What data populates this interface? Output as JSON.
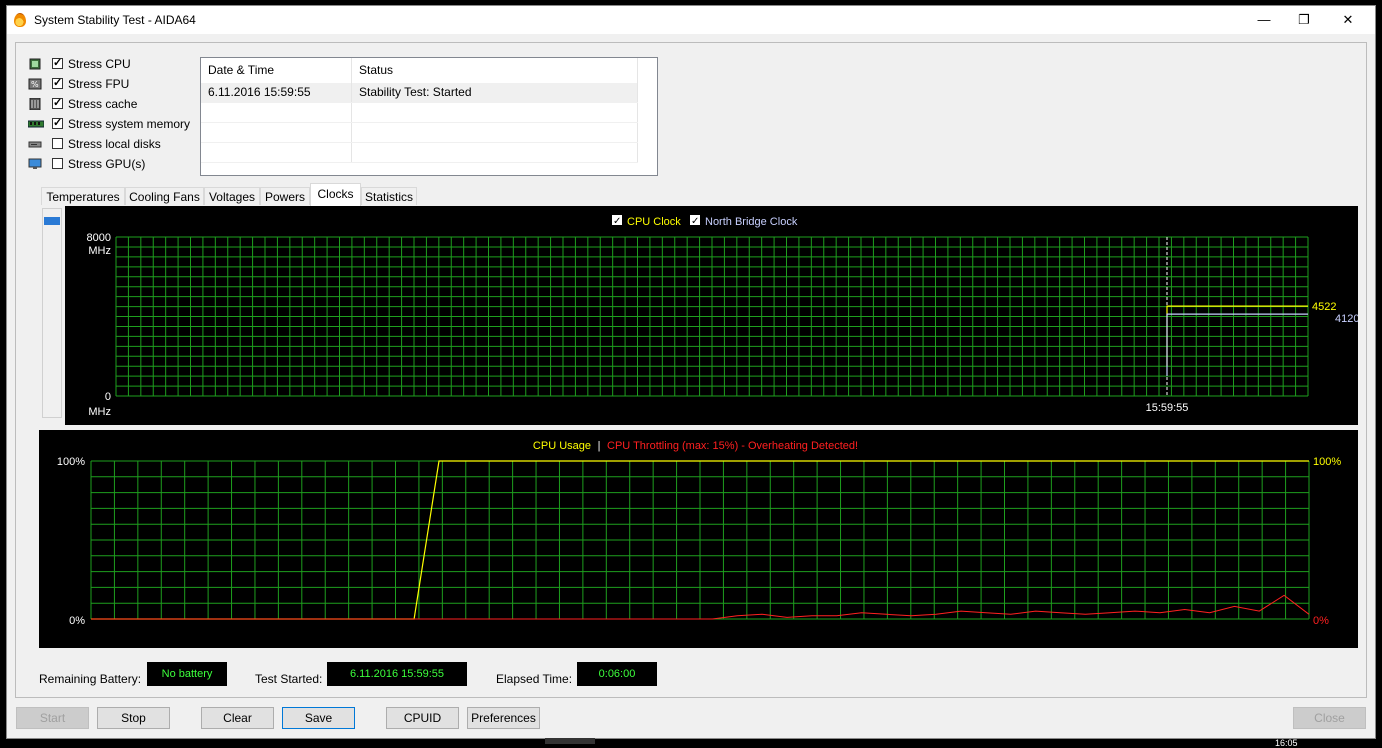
{
  "window": {
    "title": "System Stability Test - AIDA64",
    "controls": {
      "minimize": "—",
      "maximize": "❐",
      "close": "✕"
    }
  },
  "stress": [
    {
      "label": "Stress CPU",
      "checked": true,
      "icon": "cpu-icon"
    },
    {
      "label": "Stress FPU",
      "checked": true,
      "icon": "fpu-icon"
    },
    {
      "label": "Stress cache",
      "checked": true,
      "icon": "cache-icon"
    },
    {
      "label": "Stress system memory",
      "checked": true,
      "icon": "memory-icon"
    },
    {
      "label": "Stress local disks",
      "checked": false,
      "icon": "disk-icon"
    },
    {
      "label": "Stress GPU(s)",
      "checked": false,
      "icon": "monitor-icon"
    }
  ],
  "log": {
    "columns": [
      "Date & Time",
      "Status"
    ],
    "rows": [
      {
        "datetime": "6.11.2016 15:59:55",
        "status": "Stability Test: Started"
      }
    ]
  },
  "tabs": [
    "Temperatures",
    "Cooling Fans",
    "Voltages",
    "Powers",
    "Clocks",
    "Statistics"
  ],
  "active_tab": "Clocks",
  "clock_graph": {
    "legend_cpu": "CPU Clock",
    "legend_nb": "North Bridge Clock",
    "y_max_label": "8000",
    "y_max_unit": "MHz",
    "y_min_label": "0",
    "y_min_unit": "MHz",
    "time_label": "15:59:55",
    "cpu_value_label": "4522",
    "nb_value_label": "4120",
    "cpu_color": "#ffff00",
    "nb_color": "#c8d0ff",
    "grid_color": "#1e9f1e"
  },
  "chart_data": [
    {
      "type": "line",
      "title": "",
      "ylabel": "MHz",
      "ylim": [
        0,
        8000
      ],
      "x": [
        "15:59:55"
      ],
      "series": [
        {
          "name": "CPU Clock",
          "values": [
            4522
          ]
        },
        {
          "name": "North Bridge Clock",
          "values": [
            4120
          ]
        }
      ]
    },
    {
      "type": "line",
      "ylim": [
        0,
        100
      ],
      "series": [
        {
          "name": "CPU Usage",
          "values": [
            0,
            0,
            0,
            0,
            0,
            0,
            0,
            0,
            0,
            0,
            0,
            0,
            0,
            0,
            100,
            100,
            100,
            100,
            100,
            100,
            100,
            100,
            100,
            100,
            100,
            100,
            100,
            100,
            100,
            100,
            100,
            100,
            100,
            100,
            100,
            100,
            100,
            100,
            100,
            100,
            100,
            100,
            100,
            100,
            100,
            100,
            100,
            100,
            100,
            100
          ]
        },
        {
          "name": "CPU Throttling",
          "values": [
            0,
            0,
            0,
            0,
            0,
            0,
            0,
            0,
            0,
            0,
            0,
            0,
            0,
            0,
            0,
            0,
            0,
            0,
            0,
            0,
            0,
            0,
            0,
            0,
            0,
            0,
            2,
            3,
            1,
            2,
            2,
            4,
            3,
            2,
            3,
            5,
            4,
            3,
            5,
            4,
            3,
            4,
            5,
            4,
            6,
            4,
            8,
            5,
            15,
            3
          ]
        }
      ]
    }
  ],
  "usage_graph": {
    "label_usage": "CPU Usage",
    "separator": "|",
    "label_throttle": "CPU Throttling (max: 15%) - Overheating Detected!",
    "left_top": "100%",
    "left_bottom": "0%",
    "right_top": "100%",
    "right_bottom": "0%",
    "usage_color": "#ffff00",
    "throttle_color": "#ff2020"
  },
  "status": {
    "battery_label": "Remaining Battery:",
    "battery_value": "No battery",
    "started_label": "Test Started:",
    "started_value": "6.11.2016 15:59:55",
    "elapsed_label": "Elapsed Time:",
    "elapsed_value": "0:06:00"
  },
  "buttons": {
    "start": "Start",
    "stop": "Stop",
    "clear": "Clear",
    "save": "Save",
    "cpuid": "CPUID",
    "preferences": "Preferences",
    "close": "Close"
  },
  "taskbar_clock": "16:05"
}
